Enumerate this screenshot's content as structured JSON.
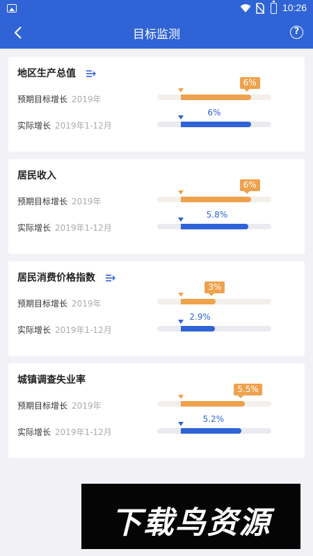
{
  "statusbar": {
    "time": "10:26"
  },
  "header": {
    "title": "目标监测"
  },
  "cards": [
    {
      "title": "地区生产总值",
      "has_icon": true,
      "expected_label": "预期目标增长",
      "expected_date": "2019年",
      "expected_value": "6%",
      "actual_label": "实际增长",
      "actual_date": "2019年1-12月",
      "actual_value": "6%"
    },
    {
      "title": "居民收入",
      "has_icon": false,
      "expected_label": "预期目标增长",
      "expected_date": "2019年",
      "expected_value": "6%",
      "actual_label": "实际增长",
      "actual_date": "2019年1-12月",
      "actual_value": "5.8%"
    },
    {
      "title": "居民消费价格指数",
      "has_icon": true,
      "expected_label": "预期目标增长",
      "expected_date": "2019年",
      "expected_value": "3%",
      "actual_label": "实际增长",
      "actual_date": "2019年1-12月",
      "actual_value": "2.9%"
    },
    {
      "title": "城镇调查失业率",
      "has_icon": false,
      "expected_label": "预期目标增长",
      "expected_date": "2019年",
      "expected_value": "5.5%",
      "actual_label": "实际增长",
      "actual_date": "2019年1-12月",
      "actual_value": "5.2%"
    }
  ],
  "watermark": {
    "text": "下载鸟资源"
  },
  "colors": {
    "primary": "#2f63d6",
    "expected": "#eea24d",
    "background": "#f2f2f6"
  }
}
